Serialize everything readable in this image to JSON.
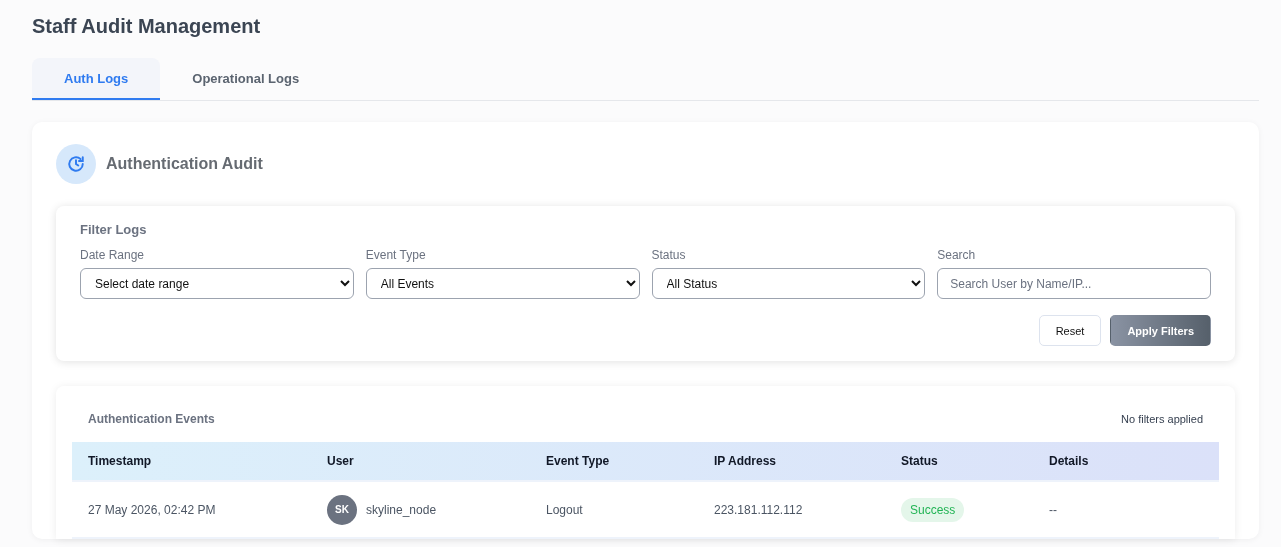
{
  "page_title": "Staff Audit Management",
  "tabs": [
    {
      "label": "Auth Logs",
      "selected": true
    },
    {
      "label": "Operational Logs",
      "selected": false
    }
  ],
  "section": {
    "title": "Authentication Audit"
  },
  "filters": {
    "title": "Filter Logs",
    "fields": [
      {
        "kind": "select",
        "label": "Date Range",
        "value": "Select date range"
      },
      {
        "kind": "select",
        "label": "Event Type",
        "value": "All Events"
      },
      {
        "kind": "select",
        "label": "Status",
        "value": "All Status"
      },
      {
        "kind": "text",
        "label": "Search",
        "placeholder": "Search User by Name/IP..."
      }
    ],
    "buttons": [
      {
        "label": "Reset",
        "kind": "secondary"
      },
      {
        "label": "Apply Filters",
        "kind": "primary"
      }
    ]
  },
  "events": {
    "title": "Authentication Events",
    "filter_note": "No filters applied",
    "columns": [
      "Timestamp",
      "User",
      "Event Type",
      "IP Address",
      "Status",
      "Details"
    ],
    "rows": [
      {
        "timestamp": "27 May 2026, 02:42 PM",
        "initials": "SK",
        "user": "skyline_node",
        "event_type": "Logout",
        "ip": "223.181.112.112",
        "status": "Success",
        "color": "#22b455",
        "details": "--"
      }
    ]
  }
}
